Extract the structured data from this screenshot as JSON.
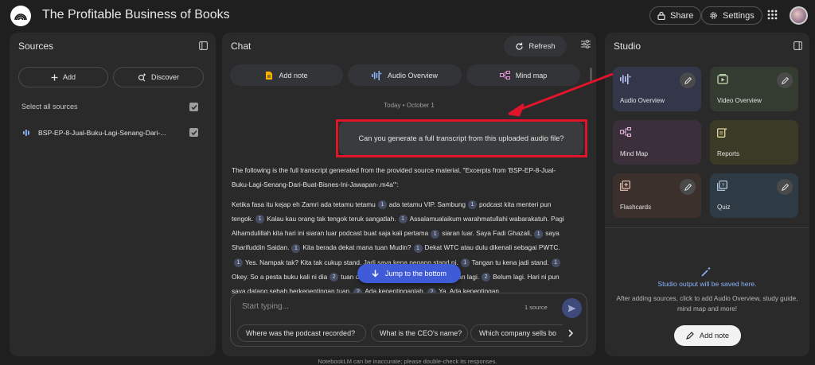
{
  "app": {
    "title": "The Profitable Business of Books",
    "share": "Share",
    "settings": "Settings"
  },
  "sources": {
    "title": "Sources",
    "add": "Add",
    "discover": "Discover",
    "select_all": "Select all sources",
    "items": [
      {
        "label": "BSP-EP-8-Jual-Buku-Lagi-Senang-Dari-..."
      }
    ]
  },
  "chat": {
    "title": "Chat",
    "refresh": "Refresh",
    "chips": [
      "Add note",
      "Audio Overview",
      "Mind map"
    ],
    "date": "Today • October 1",
    "user_message": "Can you generate a full transcript from this uploaded audio file?",
    "response_intro": "The following is the full transcript generated from the provided source material, \"Excerpts from 'BSP-EP-8-Jual-Buku-Lagi-Senang-Dari-Buat-Bisnes-Ini-Jawapan-.m4a'\":",
    "jump": "Jump to the bottom",
    "input_placeholder": "Start typing...",
    "source_count": "1 source",
    "suggestions": [
      "Where was the podcast recorded?",
      "What is the CEO's name?",
      "Which company sells bo"
    ]
  },
  "transcript": [
    [
      {
        "t": "Ketika fasa itu kejap eh Zamri ada tetamu tetamu"
      },
      {
        "c": "1"
      },
      {
        "t": "ada tetamu VIP. Sambung"
      },
      {
        "c": "1"
      },
      {
        "t": "podcast kita menteri pun tengok."
      },
      {
        "c": "1"
      },
      {
        "t": "Kalau kau orang tak tengok teruk sangatlah."
      },
      {
        "c": "1"
      },
      {
        "t": "Assalamualaikum warahmatullahi wabarakatuh. Pagi Alhamdulillah kita hari ini siaran luar podcast buat saja kali pertama"
      },
      {
        "c": "1"
      },
      {
        "t": "siaran luar. Saya Fadi Ghazali,"
      },
      {
        "c": "1"
      },
      {
        "t": "saya Sharifuddin Saidan."
      },
      {
        "c": "1"
      },
      {
        "t": "Kita berada dekat mana tuan Mudin?"
      },
      {
        "c": "1"
      },
      {
        "t": "Dekat WTC atau dulu dikenali sebagai PWTC."
      },
      {
        "c": "1"
      },
      {
        "t": "Yes. Nampak tak? Kita tak cukup stand. Jadi saya kena pegang stand ni."
      },
      {
        "c": "1"
      },
      {
        "t": "Tangan tu kena jadi stand."
      },
      {
        "c": "1"
      },
      {
        "t": "Okey. So a pesta buku kali ni dia"
      },
      {
        "c": "2"
      },
      {
        "t": "tuan dah habis lawat? Kita nak jumpa tuan lagi."
      },
      {
        "c": "2"
      },
      {
        "t": "Belum lagi. Hari ni pun saya datang sebab berkepentingan tuan."
      },
      {
        "c": "2"
      },
      {
        "t": "Ada kepentinganlah."
      },
      {
        "c": "2"
      },
      {
        "t": "Ya. Ada kepentingan"
      }
    ]
  ],
  "studio": {
    "title": "Studio",
    "tiles": [
      {
        "label": "Audio Overview",
        "color": "#34364a",
        "icon": "audio-waves-icon",
        "edit": true
      },
      {
        "label": "Video Overview",
        "color": "#343b30",
        "icon": "video-play-icon",
        "edit": true
      },
      {
        "label": "Mind Map",
        "color": "#3a2f3a",
        "icon": "mind-map-icon",
        "edit": false
      },
      {
        "label": "Reports",
        "color": "#3b3a26",
        "icon": "reports-icon",
        "edit": false
      },
      {
        "label": "Flashcards",
        "color": "#3b302c",
        "icon": "flashcards-icon",
        "edit": true
      },
      {
        "label": "Quiz",
        "color": "#2e3a44",
        "icon": "quiz-icon",
        "edit": true
      }
    ],
    "output_title": "Studio output will be saved here.",
    "output_desc": "After adding sources, click to add Audio Overview, study guide, mind map and more!",
    "add_note": "Add note"
  },
  "footer": "NotebookLM can be inaccurate; please double-check its responses.",
  "colors": {
    "accent": "#8ab4f8",
    "jump_button": "#3f5bd8",
    "highlight_box": "#e0142b",
    "arrow": "#e0142b"
  }
}
